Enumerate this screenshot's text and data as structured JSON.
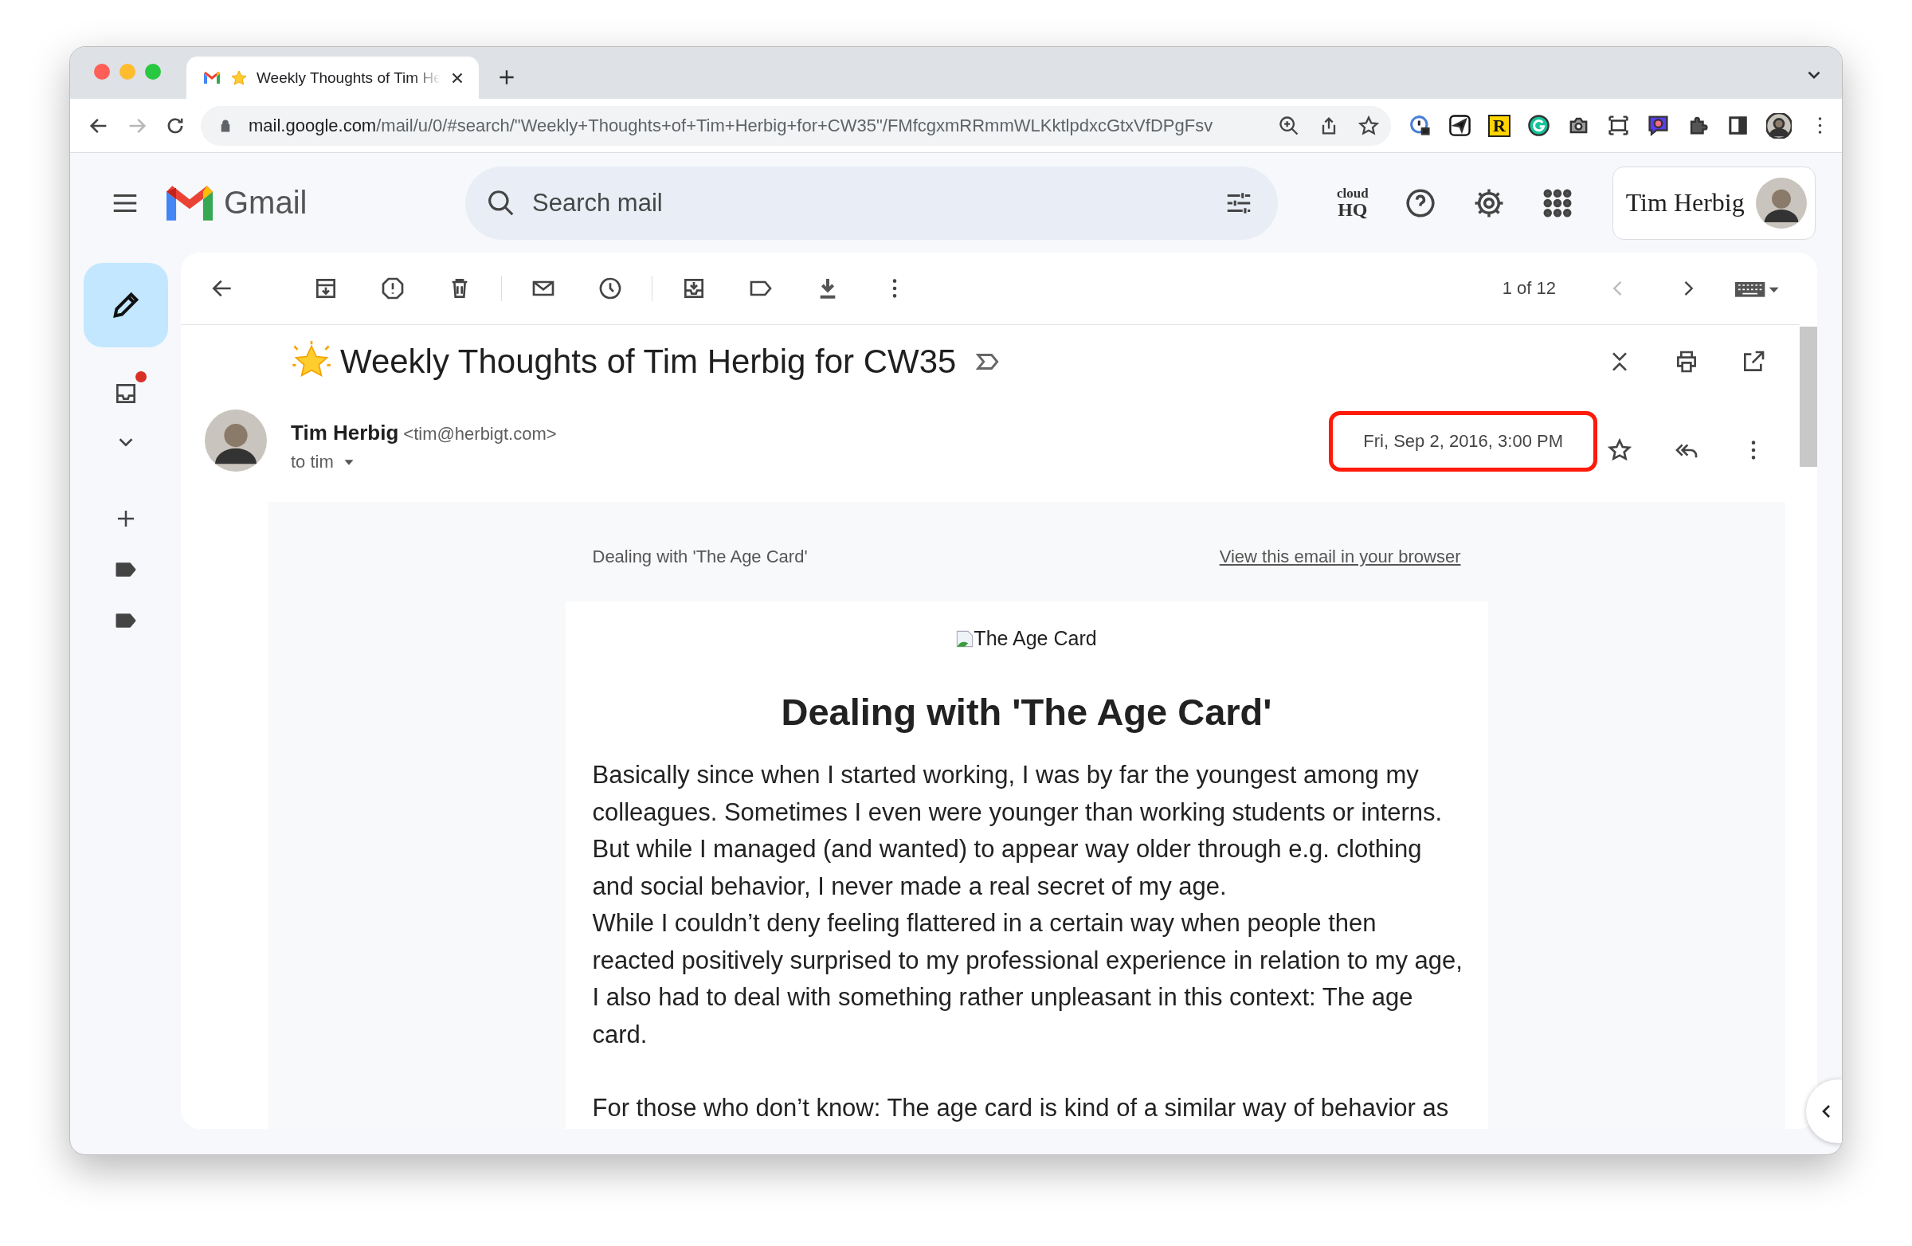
{
  "browser": {
    "tabs": [
      {
        "title": "Weekly Thoughts of Tim He",
        "selected": true
      }
    ],
    "back_disabled": false,
    "forward_disabled": true,
    "url_host": "mail.google.com",
    "url_path": "/mail/u/0/#search/\"Weekly+Thoughts+of+Tim+Herbig+for+CW35\"/FMfcgxmRRmmWLKktlpdxcGtxVfDPgFsv",
    "extension_letter": "R"
  },
  "gmail": {
    "logo": "Gmail",
    "search": {
      "placeholder": "Search mail"
    },
    "addon": {
      "top": "cloud",
      "bottom": "HQ"
    },
    "account": {
      "name": "Tim Herbig"
    },
    "inbox_unread": true
  },
  "toolbar": {
    "position": "1 of 12",
    "prev_disabled": true,
    "next_disabled": false
  },
  "message": {
    "subject": "Weekly Thoughts of Tim Herbig for CW35",
    "sender_name": "Tim Herbig",
    "sender_email": "<tim@herbigt.com>",
    "recipient": "to tim",
    "date": "Fri, Sep 2, 2016, 3:00 PM",
    "date_highlighted": true,
    "starred": false
  },
  "email_body": {
    "preheader": "Dealing with 'The Age Card'",
    "browser_link": "View this email in your browser",
    "image_alt": "The Age Card",
    "heading": "Dealing with 'The Age Card'",
    "paragraphs": [
      "Basically since when I started working, I was by far the youngest among my\ncolleagues. Sometimes I even were younger than working students or interns.\nBut while I managed (and wanted) to appear way older through e.g. clothing\nand social behavior, I never made a real secret of my age.\nWhile I couldn’t deny feeling flattered in a certain way when people then\nreacted positively surprised to my professional experience in relation to my age,\nI also had to deal with something rather unpleasant in this context: The age\ncard.",
      "For those who don’t know: The age card is kind of a similar way of behavior as"
    ]
  }
}
